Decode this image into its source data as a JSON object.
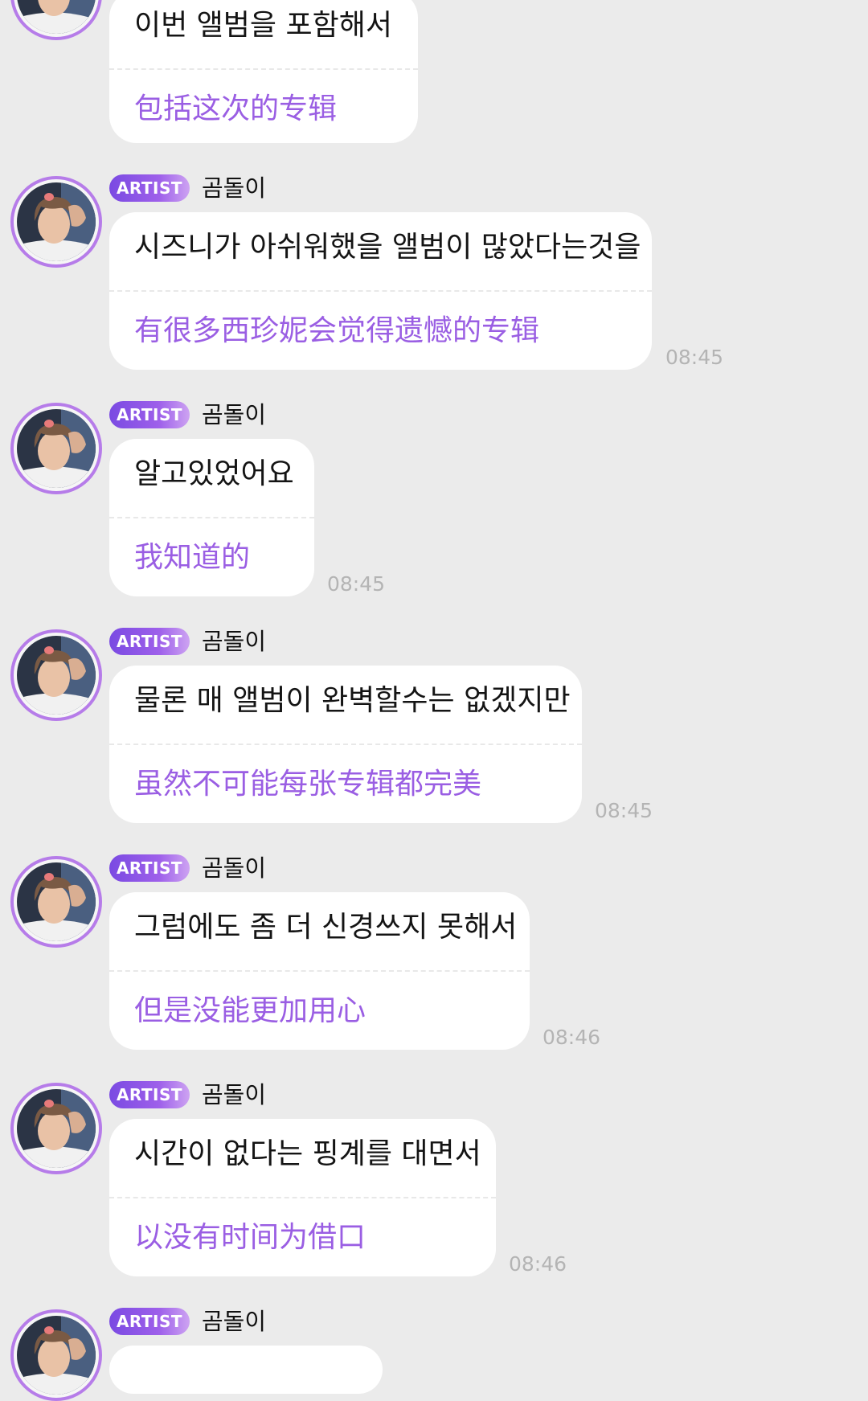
{
  "theme": {
    "background": "#ebebeb",
    "bubble": "#ffffff",
    "translation_color": "#9a5ee3",
    "badge_gradient": [
      "#7a4ae2",
      "#cda3f2"
    ],
    "avatar_ring": "#b67ce9",
    "timestamp_color": "#b4b4b4"
  },
  "messages": [
    {
      "badge": "",
      "sender": "",
      "ko": "이번 앨범을 포함해서",
      "zh": "包括这次的专辑",
      "time": ""
    },
    {
      "badge": "ARTIST",
      "sender": "곰돌이",
      "ko": "시즈니가 아쉬워했을 앨범이 많았다는것을",
      "zh": "有很多西珍妮会觉得遗憾的专辑",
      "time": "08:45"
    },
    {
      "badge": "ARTIST",
      "sender": "곰돌이",
      "ko": "알고있었어요",
      "zh": "我知道的",
      "time": "08:45"
    },
    {
      "badge": "ARTIST",
      "sender": "곰돌이",
      "ko": "물론 매 앨범이 완벽할수는 없겠지만",
      "zh": "虽然不可能每张专辑都完美",
      "time": "08:45"
    },
    {
      "badge": "ARTIST",
      "sender": "곰돌이",
      "ko": "그럼에도 좀 더 신경쓰지 못해서",
      "zh": "但是没能更加用心",
      "time": "08:46"
    },
    {
      "badge": "ARTIST",
      "sender": "곰돌이",
      "ko": "시간이 없다는 핑계를 대면서",
      "zh": "以没有时间为借口",
      "time": "08:46"
    },
    {
      "badge": "ARTIST",
      "sender": "곰돌이",
      "ko": "",
      "zh": "",
      "time": ""
    }
  ]
}
